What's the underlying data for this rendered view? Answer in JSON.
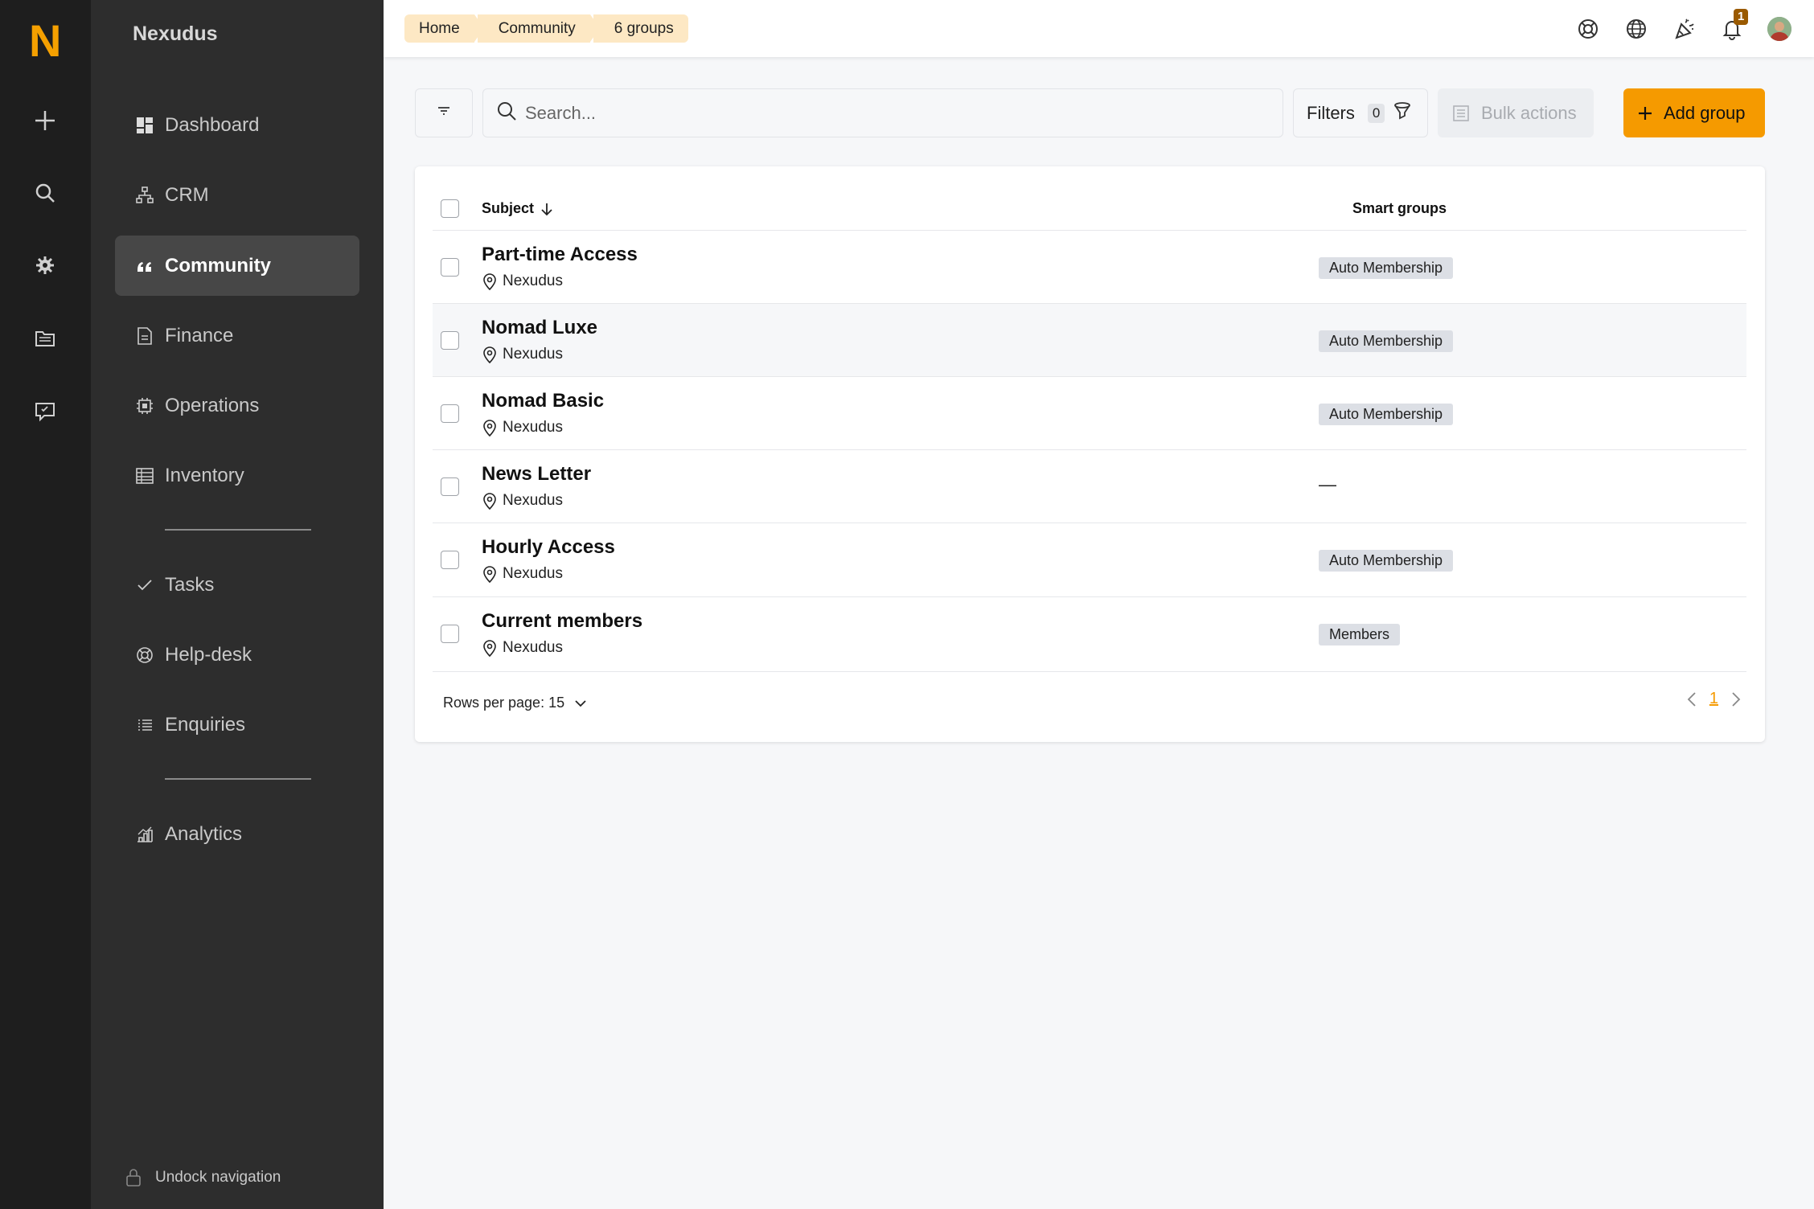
{
  "rail": {
    "logo": "N",
    "icons": [
      "plus-icon",
      "search-icon",
      "gear-icon",
      "folders-icon",
      "chat-icon"
    ]
  },
  "sidebar": {
    "brand": "Nexudus",
    "items": [
      {
        "label": "Dashboard",
        "icon": "dashboard-icon"
      },
      {
        "label": "CRM",
        "icon": "crm-icon"
      },
      {
        "label": "Community",
        "icon": "quote-icon",
        "active": true
      },
      {
        "label": "Finance",
        "icon": "document-icon"
      },
      {
        "label": "Operations",
        "icon": "chip-icon"
      },
      {
        "label": "Inventory",
        "icon": "table-icon"
      },
      {
        "label": "Tasks",
        "icon": "check-icon"
      },
      {
        "label": "Help-desk",
        "icon": "lifebuoy-icon"
      },
      {
        "label": "Enquiries",
        "icon": "list-icon"
      },
      {
        "label": "Analytics",
        "icon": "chart-icon"
      }
    ],
    "undock_label": "Undock navigation"
  },
  "breadcrumb": [
    "Home",
    "Community",
    "6 groups"
  ],
  "topbar": {
    "icons": [
      "lifebuoy-icon",
      "globe-icon",
      "party-icon",
      "bell-icon",
      "avatar"
    ],
    "notification_count": "1"
  },
  "toolbar": {
    "search_placeholder": "Search...",
    "filters_label": "Filters",
    "filters_count": "0",
    "bulk_label": "Bulk actions",
    "add_label": "Add group"
  },
  "table": {
    "columns": [
      "Subject",
      "Smart groups"
    ],
    "rows": [
      {
        "name": "Part-time Access",
        "location": "Nexudus",
        "smart_group": "Auto Membership"
      },
      {
        "name": "Nomad Luxe",
        "location": "Nexudus",
        "smart_group": "Auto Membership"
      },
      {
        "name": "Nomad Basic",
        "location": "Nexudus",
        "smart_group": "Auto Membership"
      },
      {
        "name": "News Letter",
        "location": "Nexudus",
        "smart_group": "—"
      },
      {
        "name": "Hourly Access",
        "location": "Nexudus",
        "smart_group": "Auto Membership"
      },
      {
        "name": "Current members",
        "location": "Nexudus",
        "smart_group": "Members"
      }
    ],
    "rows_per_page_label": "Rows per page: 15",
    "current_page": "1"
  },
  "colors": {
    "accent": "#f59a00",
    "rail_bg": "#1e1e1e",
    "sidebar_bg": "#2d2d2d",
    "crumb_bg": "#fde8c4"
  }
}
